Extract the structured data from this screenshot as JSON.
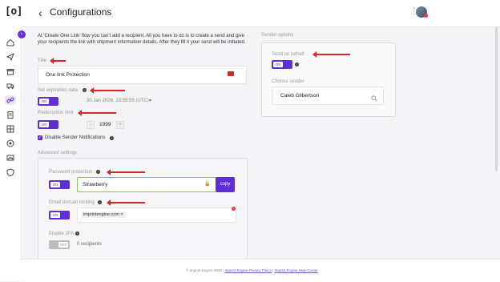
{
  "app": {
    "logo": "[o]",
    "title": "Configurations",
    "back_icon": "chevron-left-icon"
  },
  "header": {
    "menu_icon": "kebab-icon",
    "avatar": "user-avatar"
  },
  "sidebar": {
    "expand_icon": "chevron-right-icon",
    "items": [
      "home-icon",
      "send-icon",
      "gift-icon",
      "truck-icon",
      "link-icon",
      "clipboard-icon",
      "grid-icon",
      "target-icon",
      "image-icon",
      "shield-icon"
    ]
  },
  "description": "At 'Create One Link' flow you can't add a recipient. All you have to do is to create a send and give your recipients the link with shipment information details. After they fill it your send will be initiated.",
  "title_section": {
    "label": "Title",
    "value": "One link Protection"
  },
  "expiration": {
    "label": "Set expiration date",
    "toggle": "ON",
    "date": "30 Jan 2026, 23:59:59 (UTC)"
  },
  "redemption": {
    "label": "Redemption limit",
    "toggle": "ON",
    "minus": "−",
    "value": "1999",
    "plus": "+"
  },
  "notifications": {
    "label": "Disable Sender Notifications",
    "checked": true
  },
  "advanced": {
    "heading": "Advanced settings",
    "password": {
      "label": "Password protection",
      "toggle": "ON",
      "value": "Strawberry",
      "copy_label": "copy"
    },
    "email": {
      "label": "Email domain limiting",
      "toggle": "ON",
      "chip": "imprintengine.com",
      "chip_remove": "×"
    },
    "twofa": {
      "label": "Enable 2FA",
      "toggle": "OFF",
      "recipients": "0 recipients"
    }
  },
  "sender": {
    "heading": "Sender options",
    "behalf_label": "Send on behalf",
    "behalf_toggle": "ON",
    "choose_label": "Choose sender",
    "choose_value": "Caleb Gilbertson"
  },
  "footer": {
    "prefix": "© Imprint Engine 2025",
    "link1": "Imprint Engine Privacy Policy",
    "sep": "|",
    "link2": "Imprint Engine Help Center"
  },
  "colors": {
    "accent": "#5f2ed4",
    "arrow": "#d8252a"
  }
}
